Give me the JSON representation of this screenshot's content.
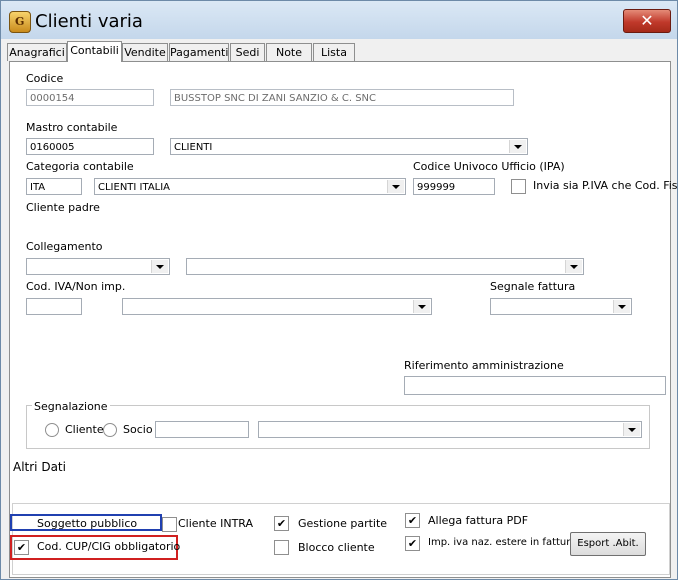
{
  "window": {
    "title": "Clienti varia",
    "close_symbol": "✕"
  },
  "tabs": [
    "Anagrafici",
    "Contabili",
    "Vendite",
    "Pagamenti",
    "Sedi",
    "Note",
    "Lista"
  ],
  "active_tab": "Contabili",
  "codice": {
    "label": "Codice",
    "value": "0000154",
    "name": "BUSSTOP SNC DI  ZANI SANZIO & C. SNC"
  },
  "mastro": {
    "label": "Mastro contabile",
    "value": "0160005",
    "desc": "CLIENTI"
  },
  "categoria": {
    "label": "Categoria contabile",
    "code": "ITA",
    "desc": "CLIENTI ITALIA"
  },
  "ipa": {
    "label": "Codice Univoco Ufficio (IPA)",
    "value": "999999"
  },
  "invia": {
    "label": "Invia sia P.IVA che Cod. Fisc",
    "checked": false
  },
  "cliente_padre": {
    "label": "Cliente padre"
  },
  "collegamento": {
    "label": "Collegamento",
    "value1": "",
    "value2": ""
  },
  "cod_iva": {
    "label": "Cod. IVA/Non imp.",
    "code": "",
    "desc": ""
  },
  "segnale": {
    "label": "Segnale fattura",
    "value": ""
  },
  "riferimento": {
    "label": "Riferimento amministrazione",
    "value": ""
  },
  "segnalazione": {
    "label": "Segnalazione",
    "opt_cliente": "Cliente",
    "opt_socio": "Socio",
    "code": "",
    "desc": ""
  },
  "altri_dati": {
    "label": "Altri Dati"
  },
  "options": {
    "soggetto_pubblico": {
      "label": "Soggetto pubblico",
      "checked": false
    },
    "cliente_intra": {
      "label": "Cliente INTRA",
      "checked": false
    },
    "gestione_partite": {
      "label": "Gestione partite",
      "checked": true
    },
    "allega_pdf": {
      "label": "Allega fattura PDF",
      "checked": true
    },
    "cod_cup_cig": {
      "label": "Cod. CUP/CIG obbligatorio",
      "checked": true
    },
    "blocco_cliente": {
      "label": "Blocco cliente",
      "checked": false
    },
    "imp_iva": {
      "label": "Imp. iva naz. estere in fattura",
      "checked": true
    },
    "esport_button": "Esport .Abit."
  },
  "check_mark": "✔",
  "colors": {
    "highlight_blue": "#2040b0",
    "highlight_red": "#d02020",
    "close_red": "#c0392b"
  }
}
